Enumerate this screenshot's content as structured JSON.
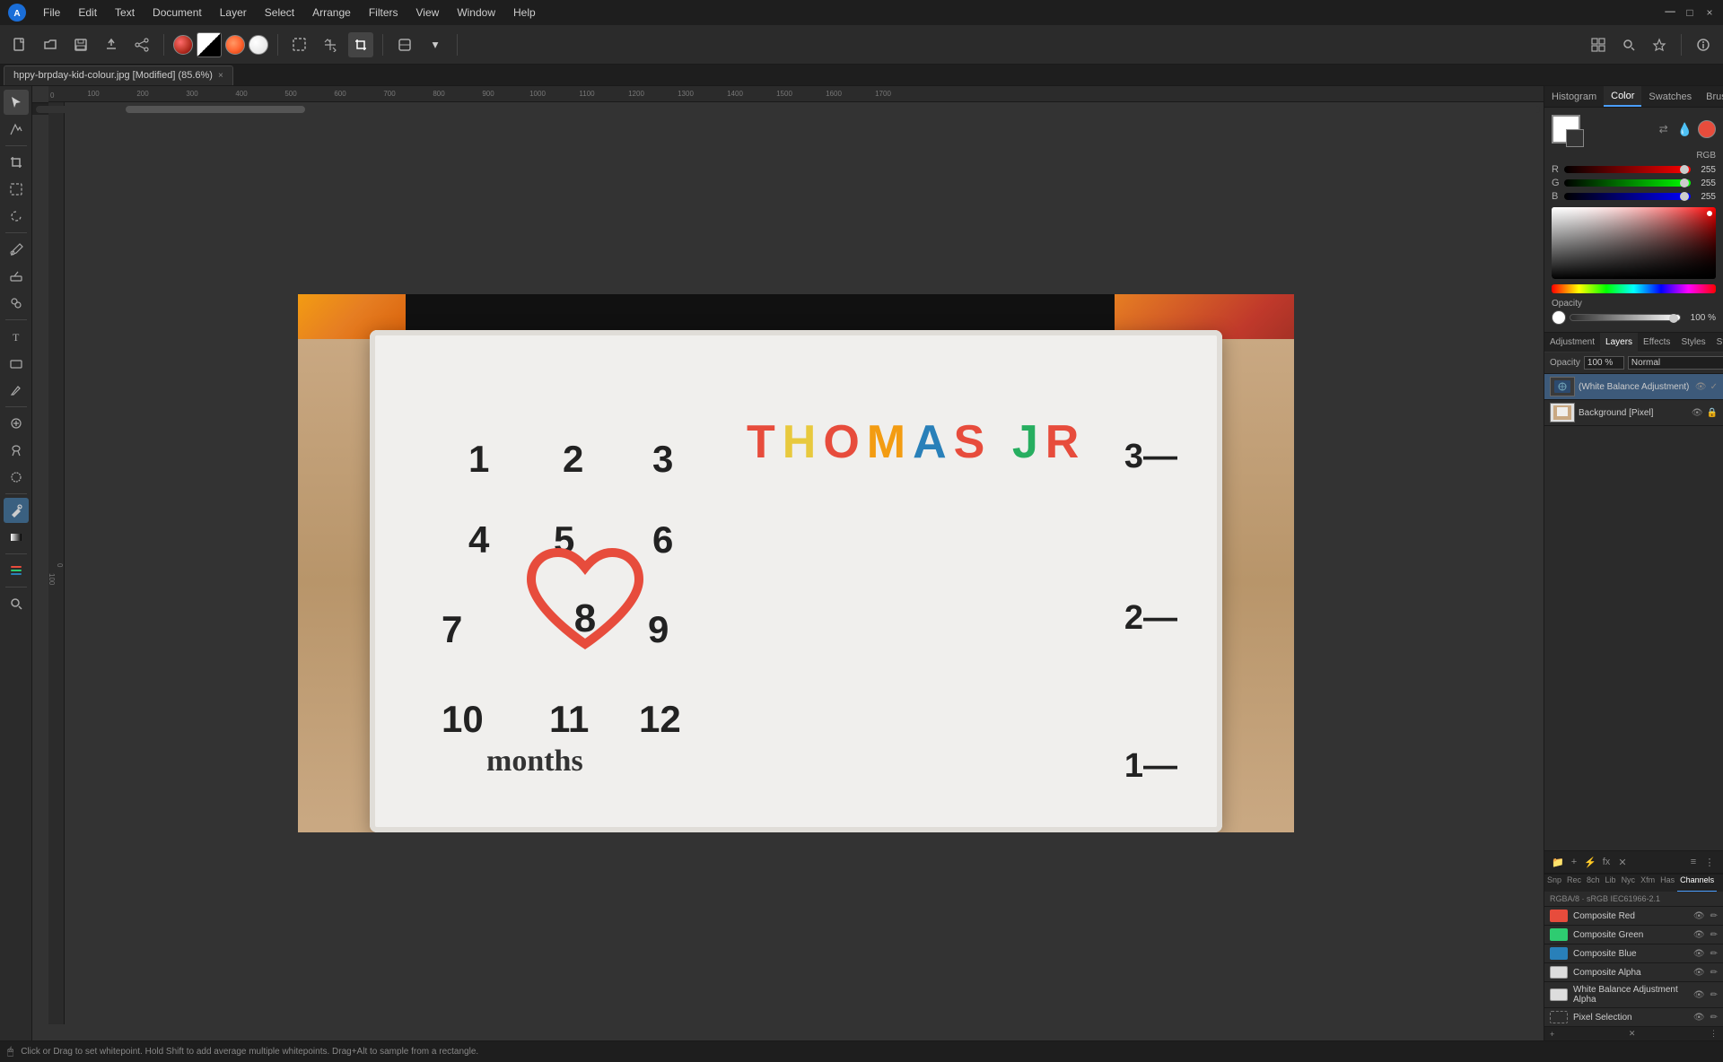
{
  "app": {
    "title": "Affinity Photo",
    "file_tab": "hppy-brpday-kid-colour.jpg [Modified] (85.6%)",
    "tab_close": "×"
  },
  "menu": {
    "items": [
      "File",
      "Edit",
      "Text",
      "Document",
      "Layer",
      "Select",
      "Arrange",
      "Filters",
      "View",
      "Window",
      "Help"
    ]
  },
  "top_right_tabs": [
    "Histogram",
    "Color",
    "Swatches",
    "Brushes"
  ],
  "color_panel": {
    "mode_label": "RGB",
    "r_label": "R",
    "g_label": "G",
    "b_label": "B",
    "r_value": "255",
    "g_value": "255",
    "b_value": "255",
    "opacity_label": "Opacity",
    "opacity_value": "100 %"
  },
  "layers_panel": {
    "title": "Layers",
    "tabs": [
      "Adjustment",
      "Layers",
      "Effects",
      "Styles",
      "Stock"
    ],
    "opacity_label": "Opacity",
    "opacity_value": "100 %",
    "blend_mode": "Normal",
    "layers": [
      {
        "name": "(White Balance Adjustment)",
        "type": "adjustment",
        "selected": true
      },
      {
        "name": "Background [Pixel]",
        "type": "pixel",
        "selected": false
      }
    ]
  },
  "channels_panel": {
    "info": "RGBA/8 · sRGB IEC61966-2.1",
    "tabs": [
      "Snp",
      "Rec",
      "8ch",
      "Lib",
      "Nyc",
      "Xfm",
      "Has",
      "Channels"
    ],
    "channels_label": "Channels",
    "channels": [
      {
        "name": "Composite Red",
        "color": "#e74c3c"
      },
      {
        "name": "Composite Green",
        "color": "#2ecc71"
      },
      {
        "name": "Composite Blue",
        "color": "#2980b9"
      },
      {
        "name": "Composite Alpha",
        "color": "#ffffff"
      },
      {
        "name": "White Balance Adjustment Alpha",
        "color": "#ffffff"
      }
    ],
    "pixel_selection": "Pixel Selection"
  },
  "statusbar": {
    "message": "Click or Drag to set whitepoint. Hold Shift to add average multiple whitepoints. Drag+Alt to sample from a rectangle."
  },
  "canvas": {
    "zoom": "85.6%",
    "numbers": [
      "1",
      "2",
      "3",
      "4",
      "5",
      "6",
      "7",
      "8",
      "9",
      "10",
      "11",
      "12"
    ],
    "title": "THOMAS JR",
    "heart_number": "8",
    "months_label": "months"
  },
  "ruler": {
    "marks": [
      100,
      200,
      300,
      400,
      500,
      600,
      700,
      800,
      900,
      1000,
      1100,
      1200,
      1300,
      1400,
      1500,
      1600,
      1700
    ]
  }
}
